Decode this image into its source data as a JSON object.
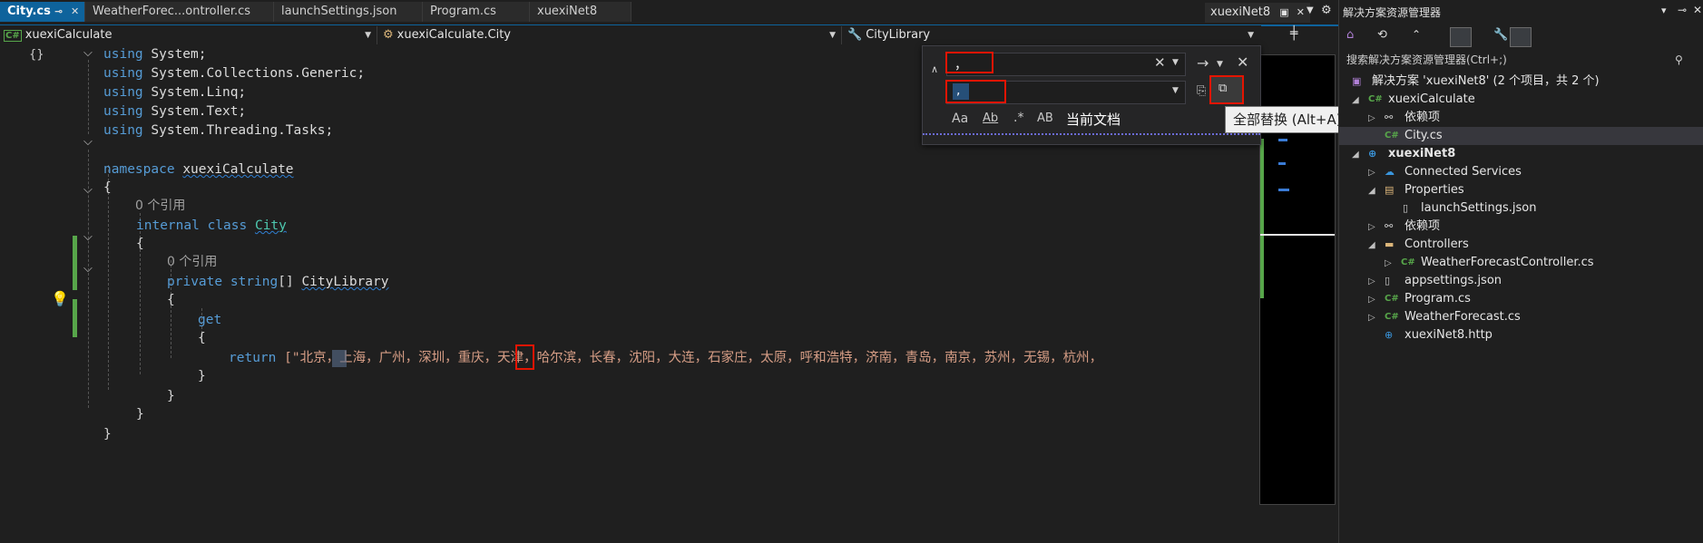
{
  "tabs": [
    {
      "label": "City.cs",
      "active": true
    },
    {
      "label": "WeatherForec...ontroller.cs",
      "active": false
    },
    {
      "label": "launchSettings.json",
      "active": false
    },
    {
      "label": "Program.cs",
      "active": false
    },
    {
      "label": "xuexiNet8",
      "active": false
    }
  ],
  "tab_right_label": "xuexiNet8",
  "nav": {
    "project": "xuexiCalculate",
    "type": "xuexiCalculate.City",
    "member": "CityLibrary"
  },
  "code": {
    "using1": "using",
    "ns_system": "System;",
    "using2": "using",
    "ns_generic": "System.Collections.Generic;",
    "using3": "using",
    "ns_linq": "System.Linq;",
    "using4": "using",
    "ns_text": "System.Text;",
    "using5": "using",
    "ns_tasks": "System.Threading.Tasks;",
    "kw_namespace": "namespace",
    "namespace_name": "xuexiCalculate",
    "brace_open_1": "{",
    "refs_class": "0 个引用",
    "kw_internal": "internal",
    "kw_class": "class",
    "class_name": "City",
    "brace_open_2": "{",
    "refs_member": "0 个引用",
    "kw_private": "private",
    "kw_string": "string",
    "array": "[]",
    "member_name": "CityLibrary",
    "brace_open_3": "{",
    "kw_get": "get",
    "brace_open_4": "{",
    "kw_return": "return",
    "return_value": "[\"北京，上海，广州，深圳，重庆，天津，哈尔滨，长春，沈阳，大连，石家庄，太原，呼和浩特，济南，青岛，南京，苏州，无锡，杭州，",
    "brace_close_4": "}",
    "brace_close_3": "}",
    "brace_close_2": "}",
    "brace_close_1": "}"
  },
  "find": {
    "search_value": "，",
    "replace_value": ",",
    "scope": "当前文档",
    "opt_case": "Aa",
    "opt_word": "Ab",
    "opt_regex": ".*",
    "opt_preserve": "AB",
    "tooltip": "全部替换 (Alt+A)"
  },
  "solution_explorer": {
    "title": "解决方案资源管理器",
    "search_placeholder": "搜索解决方案资源管理器(Ctrl+;)",
    "items": [
      {
        "label": "解决方案 'xuexiNet8' (2 个项目，共 2 个)",
        "icon": "solution-icon"
      },
      {
        "label": "xuexiCalculate",
        "icon": "csproj-icon"
      },
      {
        "label": "依赖项",
        "icon": "dependencies-icon"
      },
      {
        "label": "City.cs",
        "icon": "csharp-file-icon"
      },
      {
        "label": "xuexiNet8",
        "icon": "webproj-icon"
      },
      {
        "label": "Connected Services",
        "icon": "connected-services-icon"
      },
      {
        "label": "Properties",
        "icon": "properties-icon"
      },
      {
        "label": "launchSettings.json",
        "icon": "json-file-icon"
      },
      {
        "label": "依赖项",
        "icon": "dependencies-icon"
      },
      {
        "label": "Controllers",
        "icon": "folder-icon"
      },
      {
        "label": "WeatherForecastController.cs",
        "icon": "csharp-file-icon"
      },
      {
        "label": "appsettings.json",
        "icon": "json-file-icon"
      },
      {
        "label": "Program.cs",
        "icon": "csharp-file-icon"
      },
      {
        "label": "WeatherForecast.cs",
        "icon": "csharp-file-icon"
      },
      {
        "label": "xuexiNet8.http",
        "icon": "http-file-icon"
      }
    ]
  },
  "colors": {
    "accent": "#0e639c",
    "keyword": "#569cd6",
    "type": "#4ec9b0",
    "string": "#d69d85",
    "change_bar": "#57a64a",
    "highlight_box": "#e51400"
  }
}
